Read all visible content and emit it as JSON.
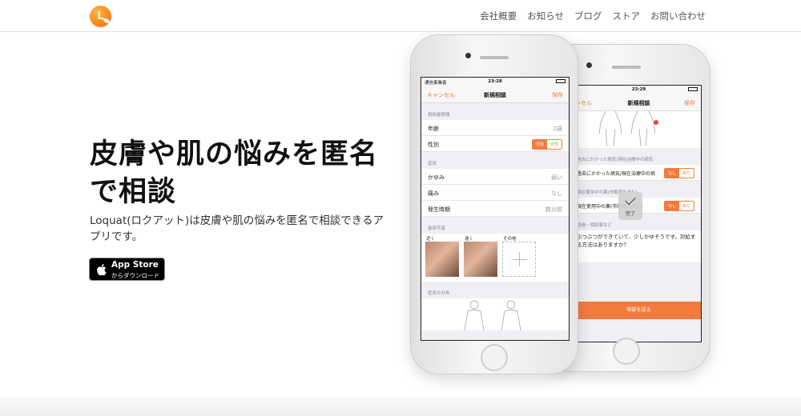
{
  "header": {
    "logo_letter": "L",
    "nav": [
      "会社概要",
      "お知らせ",
      "ブログ",
      "ストア",
      "お問い合わせ"
    ]
  },
  "hero": {
    "title_line1": "皮膚や肌の悩みを匿名",
    "title_line2": "で相談",
    "description": "Loquat(ロクアット)は皮膚や肌の悩みを匿名で相談できるアプリです。",
    "appstore_main": "App Store",
    "appstore_sub": "からダウンロード"
  },
  "front_phone": {
    "carrier": "通信事業者",
    "time": "23:28",
    "nav_left": "キャンセル",
    "nav_title": "新規相談",
    "nav_right": "保存",
    "section_profile": "相談者情報",
    "age_label": "年齢",
    "age_value": "2歳",
    "gender_label": "性別",
    "gender_options": [
      "男性",
      "女性"
    ],
    "section_symptom": "症状",
    "itch_label": "かゆみ",
    "itch_value": "弱い",
    "pain_label": "痛み",
    "pain_value": "なし",
    "onset_label": "発生時期",
    "onset_value": "数分前",
    "section_photos": "患部写真",
    "photo_labels": [
      "近く",
      "遠く",
      "その他"
    ],
    "section_distribution": "症状の分布"
  },
  "back_phone": {
    "time": "23:29",
    "nav_left": "キャンセル",
    "nav_title": "新規相談",
    "nav_right": "保存",
    "history_header": "過去にかかった病気/現在治療中の病気",
    "history_row": "過去にかかった病気/現在治療中の病",
    "meds_header": "現在使用中の薬(市販薬を含む)",
    "meds_row": "現在使用中の薬(市販薬を含む)",
    "toggle_no": "なし",
    "toggle_yes": "あり",
    "comment_header": "経過・相談事など",
    "comment_text": "ぶつぶつができていて、少しかゆそうです。対処する方法はありますか？",
    "send_button": "相談を送る",
    "done_label": "完了"
  }
}
